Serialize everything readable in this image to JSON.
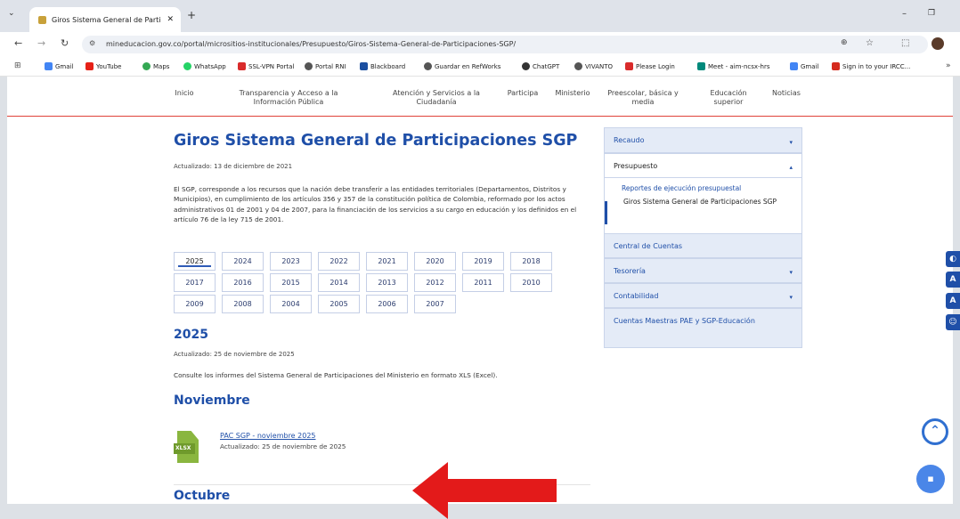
{
  "browser": {
    "tab_title": "Giros Sistema General de Partic",
    "url": "mineducacion.gov.co/portal/micrositios-institucionales/Presupuesto/Giros-Sistema-General-de-Participaciones-SGP/",
    "bookmarks": [
      "Gmail",
      "YouTube",
      "Maps",
      "WhatsApp",
      "SSL-VPN Portal",
      "Portal RNI",
      "Blackboard",
      "Guardar en RefWorks",
      "ChatGPT",
      "VIVANTO",
      "Please Login",
      "Meet - aim-ncsx-hrs",
      "Gmail",
      "Sign in to your IRCC..."
    ]
  },
  "nav": {
    "inicio": "Inicio",
    "transparencia": "Transparencia y Acceso a la Información Pública",
    "atencion": "Atención y Servicios a la Ciudadanía",
    "participa": "Participa",
    "ministerio": "Ministerio",
    "preescolar": "Preescolar, básica y media",
    "educacion": "Educación superior",
    "noticias": "Noticias"
  },
  "main": {
    "title": "Giros Sistema General de Participaciones SGP",
    "updated": "Actualizado: 13 de diciembre de 2021",
    "description": "El SGP, corresponde a los recursos que la nación debe transferir a las entidades territoriales (Departamentos, Distritos y Municipios), en cumplimiento de los artículos 356 y 357 de la constitución política de Colombia, reformado por los actos administrativos 01 de 2001 y 04 de 2007, para la financiación de los servicios a su cargo en educación y los definidos en el artículo 76 de la ley 715 de 2001.",
    "years_row1": [
      "2025",
      "2024",
      "2023",
      "2022",
      "2021",
      "2020",
      "2019",
      "2018"
    ],
    "years_row2": [
      "2017",
      "2016",
      "2015",
      "2014",
      "2013",
      "2012",
      "2011",
      "2010"
    ],
    "years_row3": [
      "2009",
      "2008",
      "2004",
      "2005",
      "2006",
      "2007"
    ],
    "section_year": "2025",
    "section_updated": "Actualizado: 25 de noviembre de 2025",
    "section_text": "Consulte los informes del Sistema General de Participaciones del Ministerio en formato XLS (Excel).",
    "month1": "Noviembre",
    "file_icon": "XLSX",
    "file_link": "PAC SGP - noviembre 2025",
    "file_updated": "Actualizado: 25 de noviembre de 2025",
    "month2": "Octubre"
  },
  "sidebar": {
    "recaudo": "Recaudo",
    "presupuesto": "Presupuesto",
    "sub1": "Reportes de ejecución presupuestal",
    "sub2": "Giros Sistema General de Participaciones SGP",
    "central": "Central de Cuentas",
    "tesoreria": "Tesorería",
    "contabilidad": "Contabilidad",
    "cuentas": "Cuentas Maestras PAE y SGP-Educación"
  },
  "colors": {
    "brand_blue": "#1f4fa8",
    "arrow_red": "#e31a1a",
    "xlsx_green": "#8ab63f"
  }
}
